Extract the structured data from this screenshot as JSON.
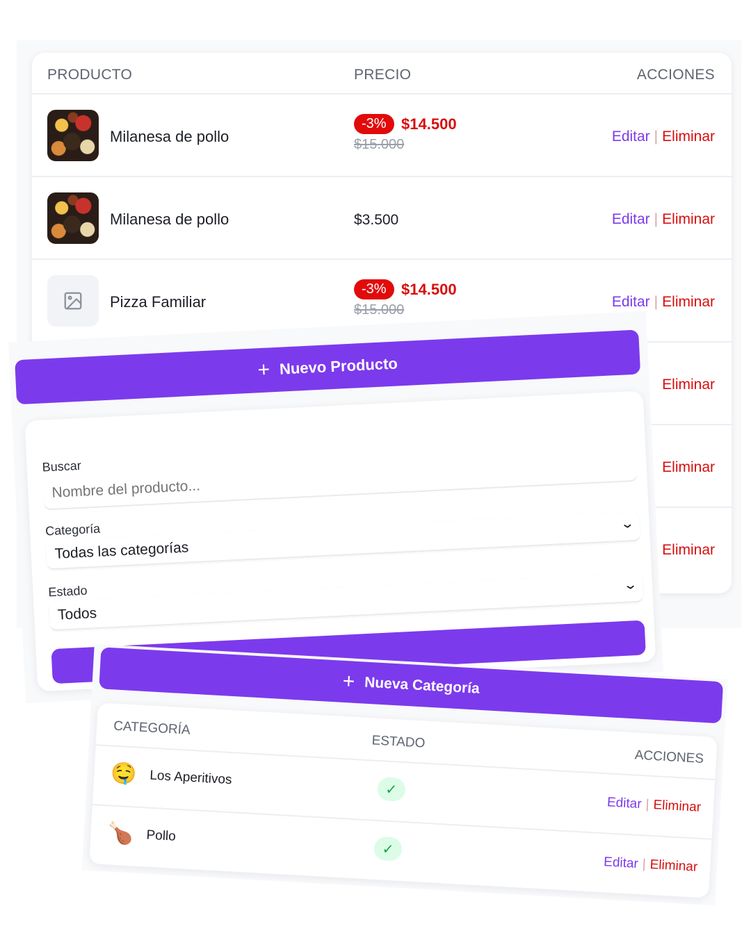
{
  "products": {
    "headers": {
      "product": "PRODUCTO",
      "price": "PRECIO",
      "actions": "ACCIONES"
    },
    "rows": [
      {
        "name": "Milanesa de pollo",
        "has_image": true,
        "discount": "-3%",
        "price": "$14.500",
        "old_price": "$15.000",
        "edit": "Editar",
        "delete": "Eliminar"
      },
      {
        "name": "Milanesa de pollo",
        "has_image": true,
        "price": "$3.500",
        "edit": "Editar",
        "delete": "Eliminar"
      },
      {
        "name": "Pizza Familiar",
        "has_image": false,
        "discount": "-3%",
        "price": "$14.500",
        "old_price": "$15.000",
        "edit": "Editar",
        "delete": "Eliminar"
      },
      {
        "delete": "Eliminar"
      },
      {
        "delete": "Eliminar"
      },
      {
        "delete": "Eliminar"
      }
    ],
    "separator": "|"
  },
  "filters": {
    "new_product": "Nuevo Producto",
    "search_label": "Buscar",
    "search_placeholder": "Nombre del producto...",
    "category_label": "Categoría",
    "category_value": "Todas las categorías",
    "status_label": "Estado",
    "status_value": "Todos"
  },
  "categories": {
    "new_category": "Nueva Categoría",
    "headers": {
      "category": "CATEGORÍA",
      "status": "ESTADO",
      "actions": "ACCIONES"
    },
    "rows": [
      {
        "emoji": "🤤",
        "name": "Los Aperitivos",
        "status": "✓",
        "edit": "Editar",
        "delete": "Eliminar"
      },
      {
        "emoji": "🍗",
        "name": "Pollo",
        "status": "✓",
        "edit": "Editar",
        "delete": "Eliminar"
      }
    ],
    "separator": "|"
  },
  "icons": {
    "plus": "+",
    "chevron": "⌄"
  },
  "colors": {
    "accent": "#7c3aed",
    "danger": "#d80e0e",
    "badge": "#e10b0b",
    "success_bg": "#dcfce7",
    "success": "#16a34a"
  }
}
